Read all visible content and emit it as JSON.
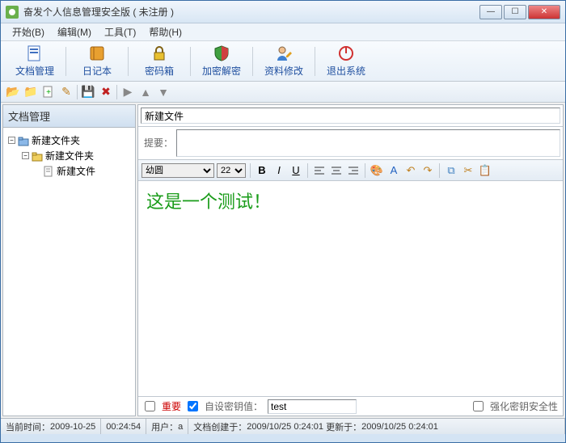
{
  "window": {
    "title": "奋发个人信息管理安全版 ( 未注册 )"
  },
  "menu": {
    "start": "开始(B)",
    "edit": "编辑(M)",
    "tools": "工具(T)",
    "help": "帮助(H)"
  },
  "toolbar": {
    "doc_manage": "文档管理",
    "diary": "日记本",
    "password_box": "密码箱",
    "encrypt": "加密解密",
    "modify": "资料修改",
    "exit": "退出系统"
  },
  "sidebar": {
    "header": "文档管理",
    "tree": {
      "root": "新建文件夹",
      "child": "新建文件夹",
      "leaf": "新建文件"
    }
  },
  "doc": {
    "title": "新建文件",
    "summary_label": "提要：",
    "summary": "",
    "body": "这是一个测试！"
  },
  "editor": {
    "font": "幼圆",
    "size": "22"
  },
  "doc_footer": {
    "important": "重要",
    "custom_key_label": "自设密钥值：",
    "key_value": "test",
    "enhance": "强化密钥安全性"
  },
  "status": {
    "now_label": "当前时间：",
    "now_date": "2009-10-25",
    "now_time": "00:24:54",
    "user_label": "用户：",
    "user": "a",
    "created_label": "文档创建于：",
    "created": "2009/10/25 0:24:01",
    "updated_label": "更新于：",
    "updated": "2009/10/25 0:24:01"
  },
  "colors": {
    "accent": "#2050a0",
    "green": "#1a9c1a"
  }
}
